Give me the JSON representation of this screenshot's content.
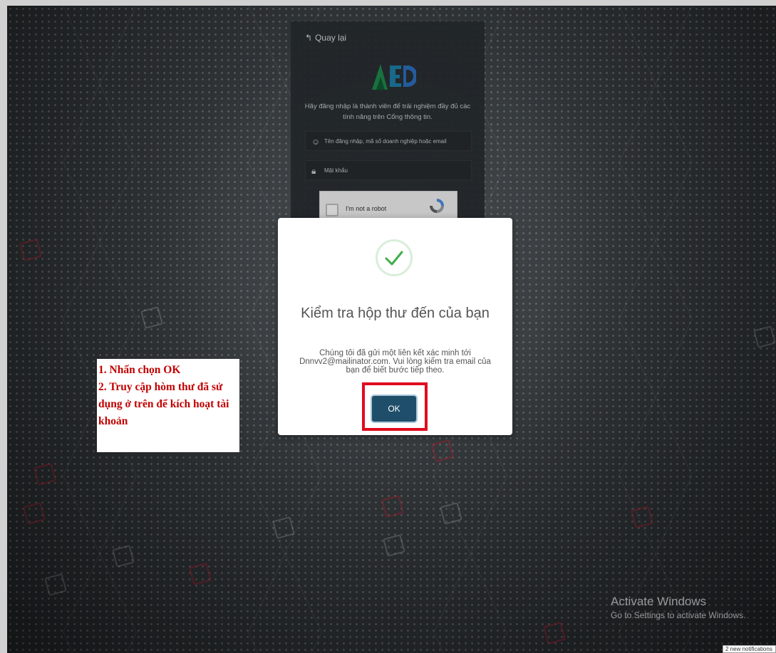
{
  "login": {
    "back_label": "Quay lại",
    "logo_text": "AED",
    "description": "Hãy đăng nhập là thành viên để trải nghiệm đầy đủ các tính năng trên Cổng thông tin.",
    "username_placeholder": "Tên đăng nhập, mã số doanh nghiệp hoặc email",
    "password_placeholder": "Mật khẩu",
    "captcha_label": "I'm not a robot"
  },
  "modal": {
    "title": "Kiểm tra hộp thư đến của bạn",
    "message": "Chúng tôi đã gửi một liên kết xác minh tới Dnnvv2@mailinator.com. Vui lòng kiểm tra email của bạn để biết bước tiếp theo.",
    "ok_label": "OK"
  },
  "instructions": {
    "step1": "1. Nhấn chọn OK",
    "step2": "2. Truy cập hòm thư đã sử dụng ở trên để kích hoạt tài khoản"
  },
  "watermark": {
    "title": "Activate Windows",
    "subtitle": "Go to Settings to activate Windows."
  },
  "notification": {
    "text": "2 new notifications"
  },
  "colors": {
    "modal_button": "#1e4e6a",
    "highlight": "#e00b1e",
    "success_check": "#3fae49",
    "instruction_text": "#c00000"
  }
}
